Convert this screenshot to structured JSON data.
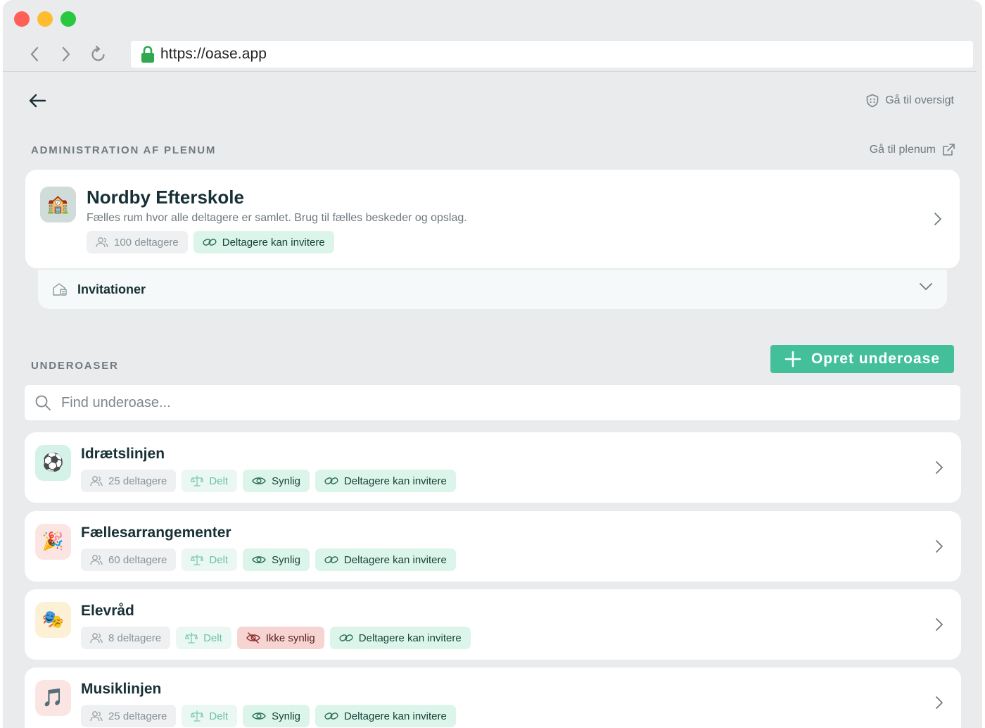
{
  "browser": {
    "url": "https://oase.app"
  },
  "top": {
    "overview_link": "Gå til oversigt"
  },
  "admin": {
    "section_label": "ADMINISTRATION AF PLENUM",
    "plenum_link": "Gå til plenum",
    "card": {
      "icon": "🏫",
      "title": "Nordby Efterskole",
      "description": "Fælles rum hvor alle deltagere er samlet. Brug til fælles beskeder og opslag.",
      "participants": "100 deltagere",
      "invite_tag": "Deltagere kan invitere"
    },
    "invitations_label": "Invitationer"
  },
  "sub": {
    "section_label": "UNDEROASER",
    "create_button": "Opret underoase",
    "search_placeholder": "Find underoase...",
    "items": [
      {
        "icon": "⚽",
        "title": "Idrætslinjen",
        "participants": "25 deltagere",
        "shared": "Delt",
        "visibility": "Synlig",
        "invite": "Deltagere kan invitere"
      },
      {
        "icon": "🎉",
        "title": "Fællesarrangementer",
        "participants": "60 deltagere",
        "shared": "Delt",
        "visibility": "Synlig",
        "invite": "Deltagere kan invitere"
      },
      {
        "icon": "🎭",
        "title": "Elevråd",
        "participants": "8 deltagere",
        "shared": "Delt",
        "visibility": "Ikke synlig",
        "invite": "Deltagere kan invitere"
      },
      {
        "icon": "🎵",
        "title": "Musiklinjen",
        "participants": "25 deltagere",
        "shared": "Delt",
        "visibility": "Synlig",
        "invite": "Deltagere kan invitere"
      }
    ]
  },
  "colors": {
    "accent": "#43c09a",
    "background": "#e9ebed",
    "visible_tag": "#dcf5ea",
    "hidden_tag": "#f6d4d2"
  }
}
